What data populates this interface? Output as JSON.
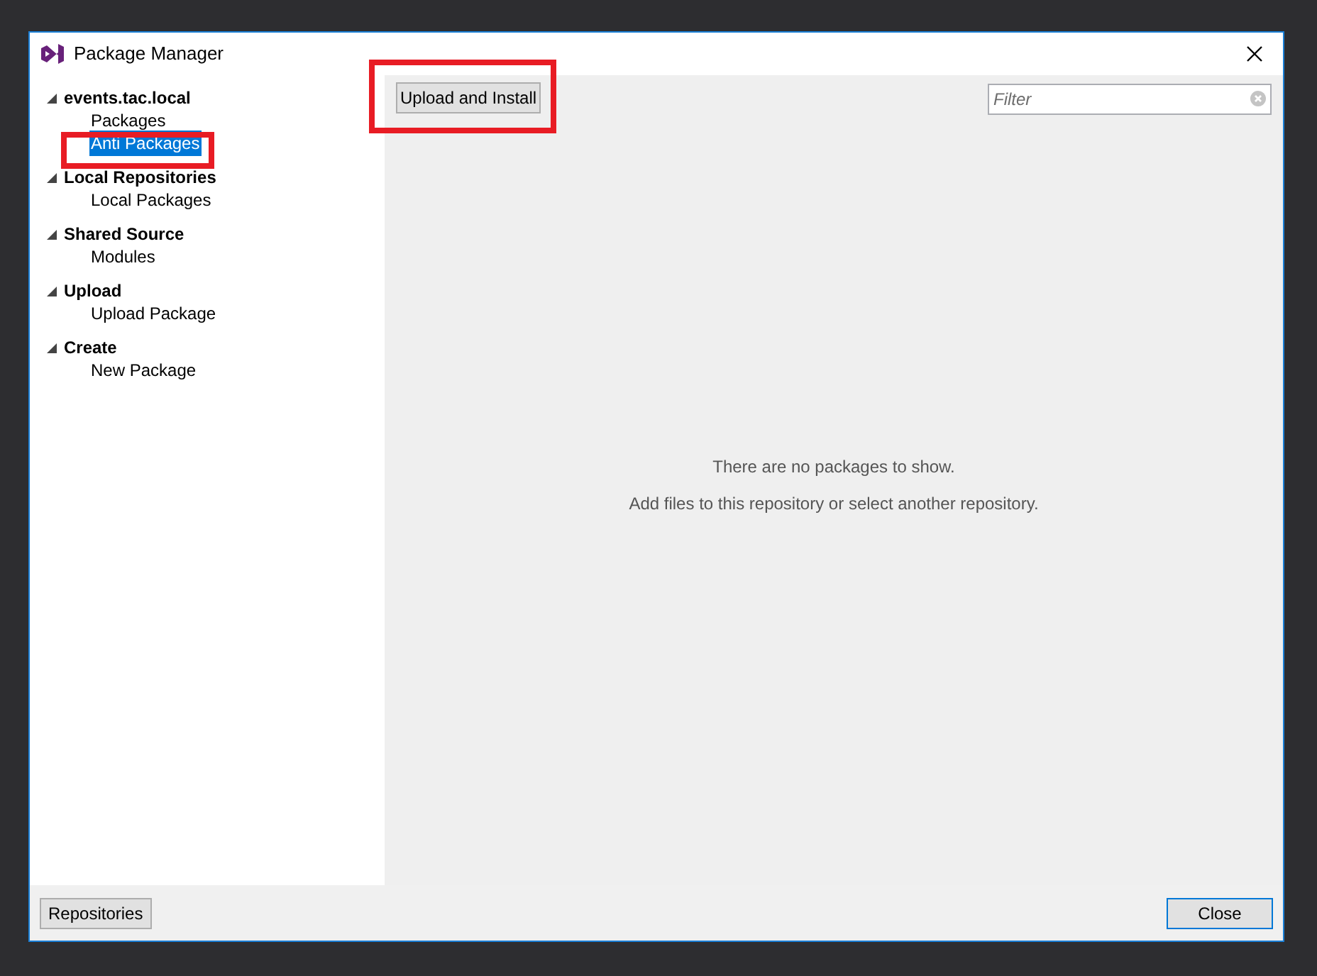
{
  "window": {
    "title": "Package Manager"
  },
  "tree": [
    {
      "label": "events.tac.local",
      "expanded": true,
      "children": [
        {
          "label": "Packages",
          "selected": false
        },
        {
          "label": "Anti Packages",
          "selected": true
        }
      ]
    },
    {
      "label": "Local Repositories",
      "expanded": true,
      "children": [
        {
          "label": "Local Packages",
          "selected": false
        }
      ]
    },
    {
      "label": "Shared Source",
      "expanded": true,
      "children": [
        {
          "label": "Modules",
          "selected": false
        }
      ]
    },
    {
      "label": "Upload",
      "expanded": true,
      "children": [
        {
          "label": "Upload Package",
          "selected": false
        }
      ]
    },
    {
      "label": "Create",
      "expanded": true,
      "children": [
        {
          "label": "New Package",
          "selected": false
        }
      ]
    }
  ],
  "toolbar": {
    "button": "Upload and Install",
    "filter": {
      "placeholder": "Filter"
    }
  },
  "empty_state": {
    "title": "There are no packages to show.",
    "hint": "Add files to this repository or select another repository."
  },
  "footer": {
    "left_button": "Repositories",
    "right_button": "Close"
  }
}
